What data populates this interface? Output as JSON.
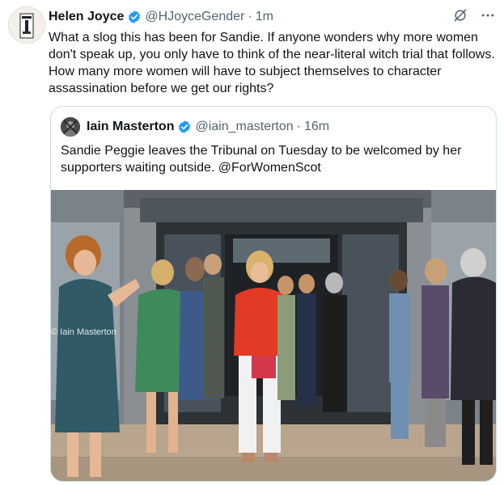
{
  "tweet": {
    "author_name": "Helen Joyce",
    "author_handle": "@HJoyceGender",
    "separator": "·",
    "time": "1m",
    "text": "What a slog this has been for Sandie. If anyone wonders why more women don't speak up, you only have to think of the near-literal witch trial that follows. How many more women will have to subject themselves to character assassination before we get our rights?",
    "icons": [
      "verified-badge-icon",
      "grok-icon",
      "more-icon"
    ]
  },
  "quote": {
    "author_name": "Iain Masterton",
    "author_handle": "@iain_masterton",
    "separator": "·",
    "time": "16m",
    "text": "Sandie Peggie leaves the Tribunal on Tuesday to be welcomed by her supporters waiting outside. @ForWomenScot",
    "photo_watermark": "© Iain Masterton"
  },
  "colors": {
    "text": "#0f1419",
    "secondary": "#536471",
    "verified": "#1d9bf0",
    "border": "#cfd9de"
  }
}
